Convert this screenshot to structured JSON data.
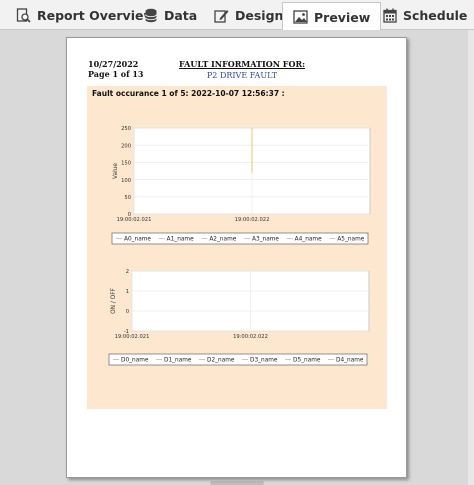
{
  "tabs": [
    {
      "label": "Report Overview",
      "icon": "report-overview-icon"
    },
    {
      "label": "Data",
      "icon": "database-icon"
    },
    {
      "label": "Design",
      "icon": "design-icon"
    },
    {
      "label": "Preview",
      "icon": "preview-icon",
      "active": true
    },
    {
      "label": "Schedule",
      "icon": "calendar-icon"
    }
  ],
  "report": {
    "date": "10/27/2022",
    "page": "Page 1 of 13",
    "title": "FAULT INFORMATION FOR:",
    "subtitle": "P2 DRIVE FAULT",
    "occurrence": "Fault occurance 1 of 5: 2022-10-07 12:56:37 :"
  },
  "colors": {
    "panel_bg": "#fde7cf",
    "subtitle": "#3344aa",
    "spike": "#e8c46a"
  },
  "chart_data": [
    {
      "type": "line",
      "title": "",
      "xlabel": "",
      "ylabel": "Value",
      "ylim": [
        0,
        250
      ],
      "yticks": [
        0,
        50,
        100,
        150,
        200,
        250
      ],
      "x_ticks": [
        "19:00:02.021",
        "19:00:02.022"
      ],
      "grid": true,
      "legend": "bottom",
      "series": [
        {
          "name": "A0_name",
          "values": []
        },
        {
          "name": "A1_name",
          "values": []
        },
        {
          "name": "A2_name",
          "values": []
        },
        {
          "name": "A3_name",
          "values": []
        },
        {
          "name": "A4_name",
          "values": []
        },
        {
          "name": "A5_name",
          "values": []
        }
      ],
      "spike": {
        "x": "19:00:02.022",
        "y_from": 120,
        "y_to": 250
      }
    },
    {
      "type": "line",
      "title": "",
      "xlabel": "",
      "ylabel": "ON / OFF",
      "ylim": [
        -1,
        2
      ],
      "yticks": [
        -1,
        0,
        1,
        2
      ],
      "x_ticks": [
        "19:00:02.021",
        "19:00:02.022"
      ],
      "grid": true,
      "legend": "bottom",
      "series": [
        {
          "name": "D0_name",
          "values": []
        },
        {
          "name": "D1_name",
          "values": []
        },
        {
          "name": "D2_name",
          "values": []
        },
        {
          "name": "D3_name",
          "values": []
        },
        {
          "name": "D5_name",
          "values": []
        },
        {
          "name": "D4_name",
          "values": []
        }
      ]
    }
  ]
}
